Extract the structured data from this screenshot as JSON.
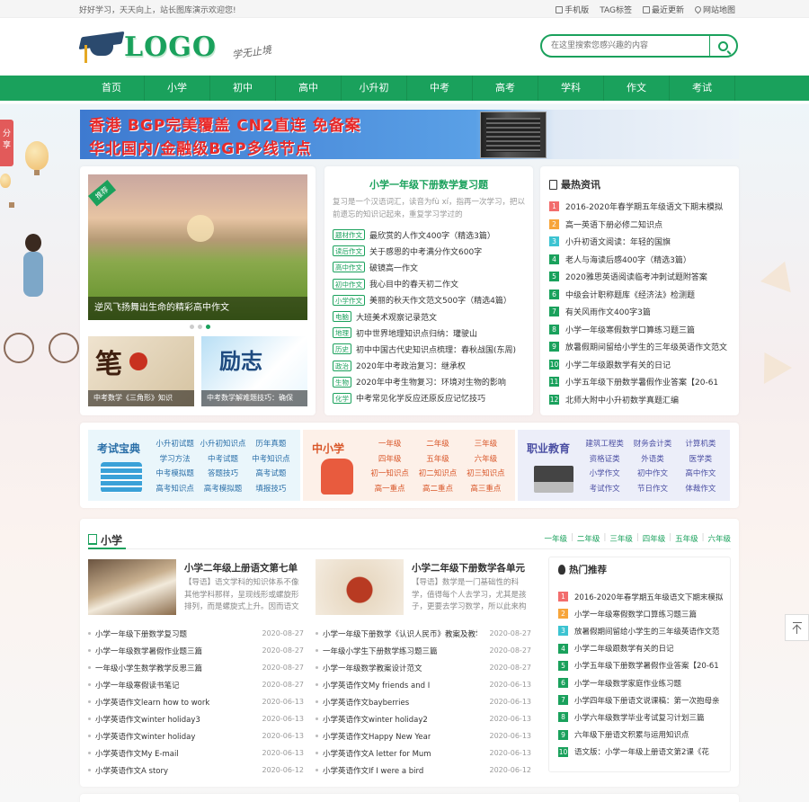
{
  "topbar": {
    "welcome": "好好学习，天天向上，站长图库演示欢迎您!",
    "links": [
      {
        "icon": "mobile-icon",
        "label": "手机版"
      },
      {
        "icon": "tag-icon",
        "label": "TAG标签"
      },
      {
        "icon": "update-icon",
        "label": "最近更新"
      },
      {
        "icon": "map-pin-icon",
        "label": "网站地图"
      }
    ]
  },
  "header": {
    "logo_text": "LOGO",
    "slogan": "学无止境",
    "search_placeholder": "在这里搜索您感兴趣的内容"
  },
  "nav": [
    "首页",
    "小学",
    "初中",
    "高中",
    "小升初",
    "中考",
    "高考",
    "学科",
    "作文",
    "考试"
  ],
  "share_label": "分享",
  "ad": {
    "line1": "香港 BGP完美覆盖 CN2直连 免备案",
    "line2": "华北国内/金融级BGP多线节点"
  },
  "slider": {
    "badge": "推荐",
    "caption": "逆风飞扬舞出生命的精彩高中作文",
    "thumbs": [
      {
        "caption": "中考数学《三角形》知识"
      },
      {
        "caption": "中考数学解难题技巧：确保"
      }
    ],
    "thumb2_text": "励志"
  },
  "featured": {
    "title": "小学一年级下册数学复习题",
    "intro": "复习是一个汉语词汇，读音为fù xí，指再一次学习，把以前遗忘的知识记起来，重复学习学过的",
    "items": [
      {
        "tag": "题材作文",
        "title": "最欣赏的人作文400字（精选3篇）"
      },
      {
        "tag": "读后作文",
        "title": "关于感恩的中考满分作文600字"
      },
      {
        "tag": "高中作文",
        "title": "破镜高一作文"
      },
      {
        "tag": "初中作文",
        "title": "我心目中的春天初二作文"
      },
      {
        "tag": "小学作文",
        "title": "美丽的秋天作文范文500字（精选4篇）"
      },
      {
        "tag": "电脑",
        "title": "大班美术观察记录范文"
      },
      {
        "tag": "地理",
        "title": "初中世界地理知识点归纳：瓘驶山"
      },
      {
        "tag": "历史",
        "title": "初中中国古代史知识点梳理：春秋战国(东周)"
      },
      {
        "tag": "政治",
        "title": "2020年中考政治复习：继承权"
      },
      {
        "tag": "生物",
        "title": "2020年中考生物复习：环境对生物的影响"
      },
      {
        "tag": "化学",
        "title": "中考常见化学反应还原反应记忆技巧"
      }
    ]
  },
  "hot_news": {
    "title": "最热资讯",
    "items": [
      "2016-2020年春学期五年级语文下期末模拟",
      "高一英语下册必修二知识点",
      "小升初语文阅读：年轻的国旗",
      "老人与海读后感400字（精选3篇）",
      "2020雅思英语阅读临考冲刺试题附答案",
      "中级会计职称题库《经济法》检测题",
      "有关风雨作文400字3篇",
      "小学一年级寒假数学口算练习题三篇",
      "放暑假期间留给小学生的三年级英语作文范文",
      "小学二年级跟数学有关的日记",
      "小学五年级下册数学暑假作业答案【20-61",
      "北师大附中小升初数学真题汇编"
    ]
  },
  "categories": [
    {
      "title": "考试宝典",
      "links": [
        "小升初试题",
        "小升初知识点",
        "历年真题",
        "学习方法",
        "中考试题",
        "中考知识点",
        "中考模拟题",
        "答题技巧",
        "高考试题",
        "高考知识点",
        "高考模拟题",
        "填报技巧"
      ]
    },
    {
      "title": "中小学",
      "links": [
        "一年级",
        "二年级",
        "三年级",
        "四年级",
        "五年级",
        "六年级",
        "初一知识点",
        "初二知识点",
        "初三知识点",
        "高一重点",
        "高二重点",
        "高三重点"
      ]
    },
    {
      "title": "职业教育",
      "links": [
        "建筑工程类",
        "财务会计类",
        "计算机类",
        "资格证类",
        "外语类",
        "医学类",
        "小学作文",
        "初中作文",
        "高中作文",
        "考试作文",
        "节日作文",
        "体裁作文"
      ]
    }
  ],
  "section": {
    "title": "小学",
    "grades": [
      "一年级",
      "二年级",
      "三年级",
      "四年级",
      "五年级",
      "六年级"
    ],
    "features": [
      {
        "title": "小学二年级上册语文第七单",
        "desc": "【导语】语文学科的知识体系不像其他学科那样，呈现线形或螺旋形排列，而是螺旋式上升。因而语文学..."
      },
      {
        "title": "小学二年级下册数学各单元",
        "desc": "【导语】数学是一门基础性的科学，值得每个人去学习，尤其是孩子，更要去学习数学，所以此来构架自..."
      }
    ],
    "list_left": [
      {
        "title": "小学一年级下册数学复习题",
        "date": "2020-08-27"
      },
      {
        "title": "小学一年级数学暑假作业题三篇",
        "date": "2020-08-27"
      },
      {
        "title": "一年级小学生数学教学反思三篇",
        "date": "2020-08-27"
      },
      {
        "title": "小学一年级寒假读书笔记",
        "date": "2020-08-27"
      },
      {
        "title": "小学英语作文learn how to work",
        "date": "2020-06-13"
      },
      {
        "title": "小学英语作文winter holiday3",
        "date": "2020-06-13"
      },
      {
        "title": "小学英语作文winter holiday",
        "date": "2020-06-13"
      },
      {
        "title": "小学英语作文My E-mail",
        "date": "2020-06-13"
      },
      {
        "title": "小学英语作文A story",
        "date": "2020-06-12"
      }
    ],
    "list_right": [
      {
        "title": "小学一年级下册数学《认识人民币》教案及教学",
        "date": "2020-08-27"
      },
      {
        "title": "一年级小学生下册数学练习题三篇",
        "date": "2020-08-27"
      },
      {
        "title": "小学一年级数学教案设计范文",
        "date": "2020-08-27"
      },
      {
        "title": "小学英语作文My friends and I",
        "date": "2020-06-13"
      },
      {
        "title": "小学英语作文bayberries",
        "date": "2020-06-13"
      },
      {
        "title": "小学英语作文winter holiday2",
        "date": "2020-06-13"
      },
      {
        "title": "小学英语作文Happy New Year",
        "date": "2020-06-13"
      },
      {
        "title": "小学英语作文A letter for Mum",
        "date": "2020-06-13"
      },
      {
        "title": "小学英语作文If I were a bird",
        "date": "2020-06-12"
      }
    ],
    "hot_title": "热门推荐",
    "hot_items": [
      "2016-2020年春学期五年级语文下期末模拟",
      "小学一年级寒假数学口算练习题三篇",
      "放暑假期间留给小学生的三年级英语作文范",
      "小学二年级跟数学有关的日记",
      "小学五年级下册数学暑假作业答案【20-61",
      "小学一年级数学家庭作业练习题",
      "小学四年级下册语文说课稿：第一次抱母亲",
      "小学六年级数学毕业考试复习计划三篇",
      "六年级下册语文积累与运用知识点",
      "语文版：小学一年级上册语文第2课《花"
    ]
  },
  "colors": {
    "brand": "#1aa15c",
    "rank1": "#f26d6d",
    "rank2": "#f7a53a",
    "rank3": "#3cc3d1"
  }
}
